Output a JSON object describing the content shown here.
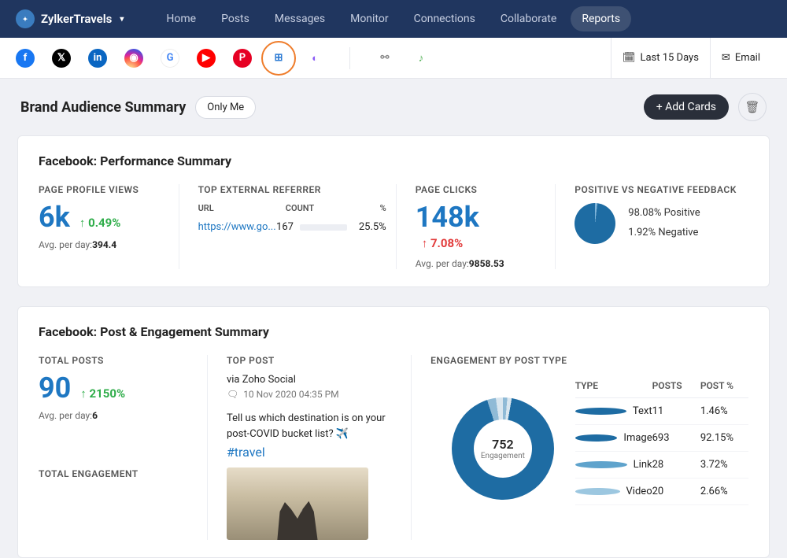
{
  "brand": "ZylkerTravels",
  "nav": [
    "Home",
    "Posts",
    "Messages",
    "Monitor",
    "Connections",
    "Collaborate",
    "Reports"
  ],
  "nav_active": 6,
  "daterange": "Last 15 Days",
  "email_label": "Email",
  "page_title": "Brand Audience Summary",
  "scope_pill": "Only Me",
  "add_cards": "+ Add Cards",
  "card1": {
    "title": "Facebook: Performance Summary",
    "views": {
      "label": "PAGE PROFILE VIEWS",
      "value": "6k",
      "trend": "0.49%",
      "dir": "up",
      "avg_label": "Avg. per day:",
      "avg": "394.4"
    },
    "referrer": {
      "label": "TOP EXTERNAL REFERRER",
      "cols": [
        "URL",
        "COUNT",
        "%"
      ],
      "url": "https://www.go...",
      "count": "167",
      "pct": "25.5%"
    },
    "clicks": {
      "label": "PAGE CLICKS",
      "value": "148k",
      "trend": "7.08%",
      "dir": "down",
      "avg_label": "Avg. per day:",
      "avg": "9858.53"
    },
    "feedback": {
      "label": "POSITIVE VS NEGATIVE FEEDBACK",
      "pos": "98.08%  Positive",
      "neg": "1.92%  Negative"
    }
  },
  "card2": {
    "title": "Facebook: Post & Engagement Summary",
    "posts": {
      "label": "TOTAL POSTS",
      "value": "90",
      "trend": "2150%",
      "dir": "up",
      "avg_label": "Avg. per day:",
      "avg": "6"
    },
    "total_eng_label": "TOTAL ENGAGEMENT",
    "top": {
      "label": "TOP POST",
      "via": "via Zoho Social",
      "date": "10 Nov 2020 04:35 PM",
      "text": "Tell us which destination is on your post-COVID bucket list? ✈️",
      "hashtag": "#travel"
    },
    "eng": {
      "label": "ENGAGEMENT BY POST TYPE",
      "total": "752",
      "total_label": "Engagement",
      "cols": [
        "TYPE",
        "POSTS",
        "POST %"
      ],
      "rows": [
        {
          "type": "Text",
          "posts": "11",
          "pct": "1.46%",
          "color": "#1e6ca3"
        },
        {
          "type": "Image",
          "posts": "693",
          "pct": "92.15%",
          "color": "#1e6ca3"
        },
        {
          "type": "Link",
          "posts": "28",
          "pct": "3.72%",
          "color": "#5fa3cc"
        },
        {
          "type": "Video",
          "posts": "20",
          "pct": "2.66%",
          "color": "#9cc7e0"
        }
      ]
    }
  },
  "chart_data": [
    {
      "type": "pie",
      "title": "Positive vs Negative Feedback",
      "series": [
        {
          "name": "Positive",
          "value": 98.08
        },
        {
          "name": "Negative",
          "value": 1.92
        }
      ]
    },
    {
      "type": "pie",
      "title": "Engagement by Post Type",
      "total": 752,
      "series": [
        {
          "name": "Text",
          "value": 11,
          "pct": 1.46
        },
        {
          "name": "Image",
          "value": 693,
          "pct": 92.15
        },
        {
          "name": "Link",
          "value": 28,
          "pct": 3.72
        },
        {
          "name": "Video",
          "value": 20,
          "pct": 2.66
        }
      ]
    },
    {
      "type": "bar",
      "title": "Top External Referrer",
      "categories": [
        "https://www.go..."
      ],
      "values": [
        167
      ],
      "pct": [
        25.5
      ]
    }
  ]
}
